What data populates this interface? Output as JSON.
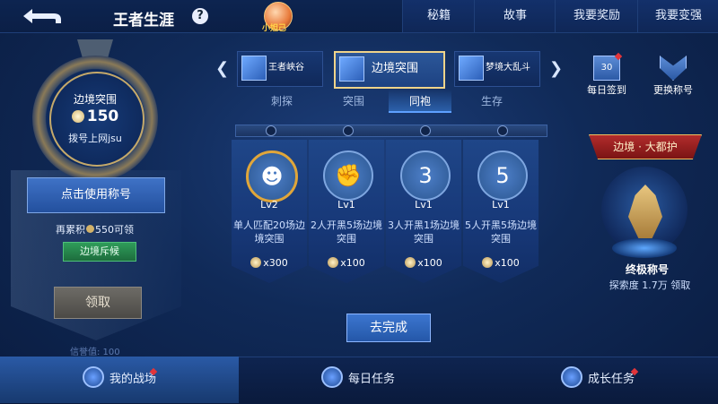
{
  "header": {
    "title": "王者生涯",
    "help": "?",
    "avatar_name": "小妲己",
    "buttons": [
      "秘籍",
      "故事",
      "我要奖励",
      "我要变强"
    ]
  },
  "left_panel": {
    "mode_name": "边境突围",
    "points": "150",
    "player": "拨号上网jsu",
    "use_title": "点击使用称号",
    "accumulate_prefix": "再累积",
    "accumulate_amount": "550可领",
    "scout_badge": "边境斥候",
    "claim": "领取",
    "credit": "信誉值: 100"
  },
  "mode_tabs": [
    "王者峡谷",
    "边境突围",
    "梦境大乱斗"
  ],
  "mode_tab_selected": 1,
  "sub_tabs": [
    "刺探",
    "突围",
    "同袍",
    "生存"
  ],
  "sub_tab_selected": 2,
  "cards": [
    {
      "icon": "hooded-icon",
      "glyph": "☻",
      "level": "Lv2",
      "desc": "单人匹配20场边境突围",
      "reward": "x300"
    },
    {
      "icon": "handshake-icon",
      "glyph": "✊",
      "level": "Lv1",
      "desc": "2人开黑5场边境突围",
      "reward": "x100"
    },
    {
      "icon": "fist-3-icon",
      "glyph": "3",
      "level": "Lv1",
      "desc": "3人开黑1场边境突围",
      "reward": "x100"
    },
    {
      "icon": "fist-5-icon",
      "glyph": "5",
      "level": "Lv1",
      "desc": "5人开黑5场边境突围",
      "reward": "x100"
    }
  ],
  "complete_button": "去完成",
  "right_panel": {
    "daily_checkin": "每日签到",
    "checkin_day": "30",
    "change_title": "更换称号",
    "rank_banner": "边境 · 大都护",
    "ultimate_title": "终极称号",
    "explore_text": "探索度 1.7万 领取"
  },
  "bottom_tabs": [
    "我的战场",
    "每日任务",
    "成长任务"
  ],
  "bottom_tab_selected": 0,
  "colors": {
    "accent": "#f0d48a",
    "highlight": "#e0a63a",
    "notify": "#e2353a"
  }
}
